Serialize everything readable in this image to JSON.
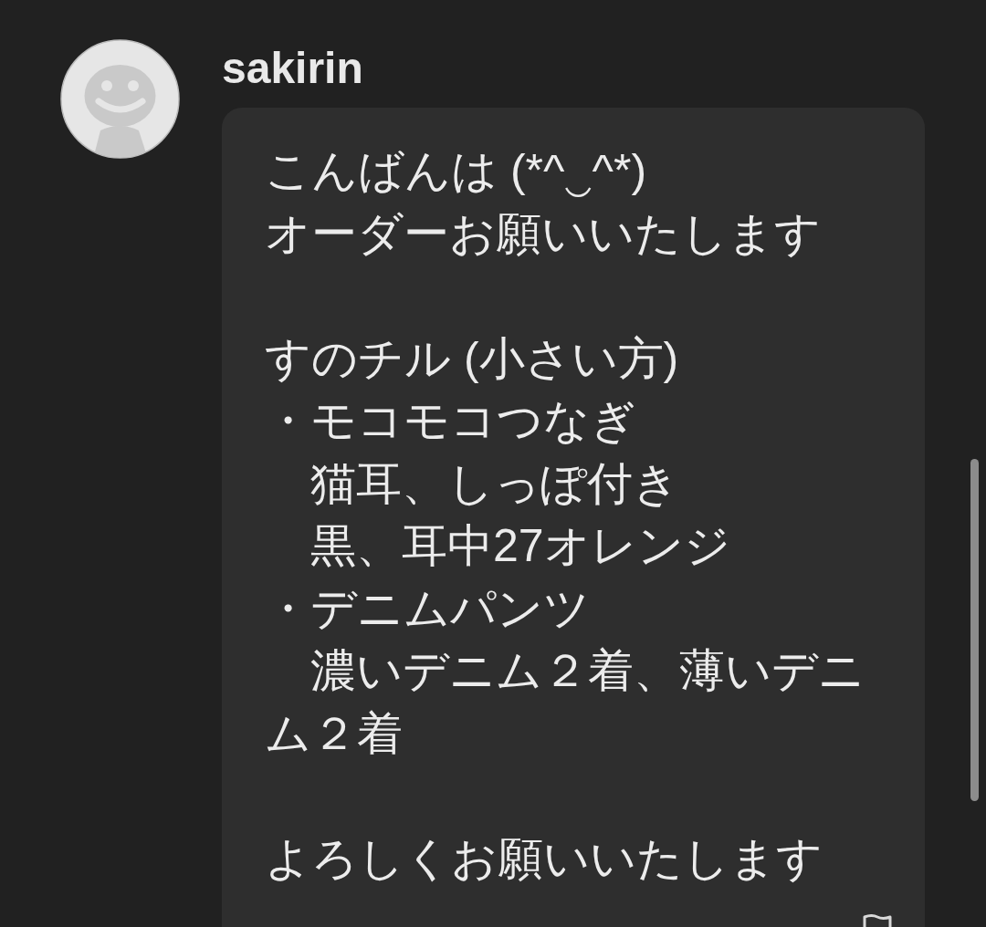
{
  "user": {
    "name": "sakirin"
  },
  "message": {
    "paragraphs": [
      {
        "lines": [
          "こんばんは (*^‿^*)",
          "オーダーお願いいたします"
        ]
      },
      {
        "lines": [
          "すのチル (小さい方)",
          "・モコモコつなぎ",
          "　猫耳、しっぽ付き",
          "　黒、耳中27オレンジ",
          "・デニムパンツ",
          "　濃いデニム２着、薄いデニム２着"
        ]
      },
      {
        "lines": [
          "よろしくお願いいたします"
        ]
      }
    ]
  }
}
